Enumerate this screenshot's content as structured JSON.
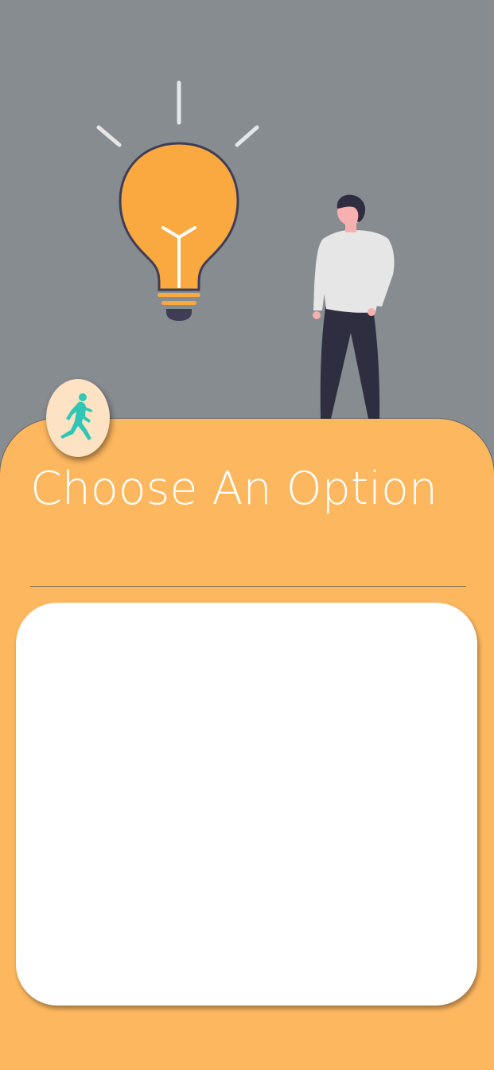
{
  "screen": {
    "title": "Choose An Option"
  },
  "illustration": {
    "items": [
      "lightbulb-icon",
      "person-illustration"
    ]
  },
  "logo": {
    "icon": "runner-icon"
  },
  "colors": {
    "background": "#878c91",
    "sheet": "#fdb75f",
    "card": "#ffffff",
    "bulb": "#f9a93f",
    "badge": "#fde3c3",
    "runner": "#2fc6b6"
  }
}
